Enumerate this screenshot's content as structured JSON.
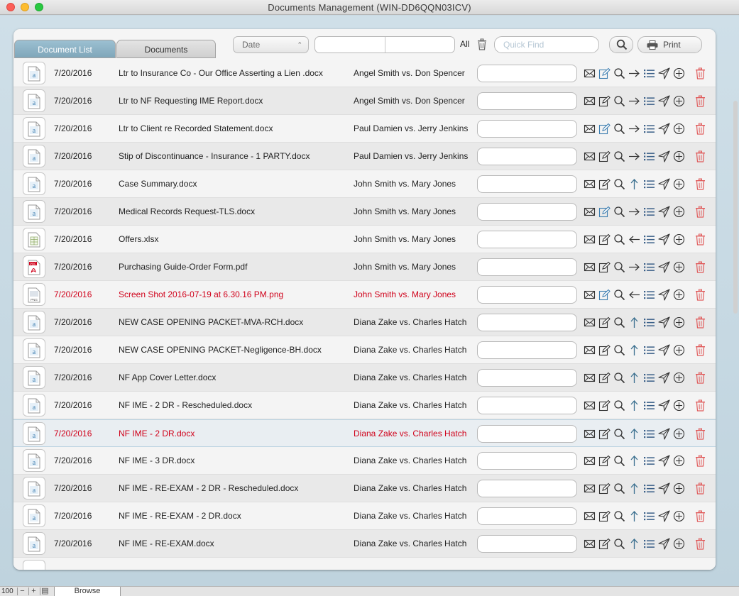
{
  "window": {
    "title": "Documents  Management (WIN-DD6QQN03ICV)"
  },
  "tabs": [
    {
      "label": "Document List",
      "active": true
    },
    {
      "label": "Documents",
      "active": false
    }
  ],
  "toolbar": {
    "date_select": "Date",
    "all_label": "All",
    "quickfind_placeholder": "Quick Find",
    "print_label": "Print"
  },
  "colors": {
    "accent": "#7fa6ba",
    "alert_red": "#d0021b",
    "trash_red": "#e05a5a",
    "icon_blue": "#3f7fb1"
  },
  "rows": [
    {
      "icon": "word-doc-icon",
      "date": "7/20/2016",
      "name": "Ltr to Insurance Co - Our Office Asserting a Lien .docx",
      "case": "Angel Smith vs. Don Spencer",
      "direction": "right-arrow-icon",
      "edit_blue": true,
      "red": false
    },
    {
      "icon": "word-doc-icon",
      "date": "7/20/2016",
      "name": "Ltr to NF Requesting IME Report.docx",
      "case": "Angel Smith vs. Don Spencer",
      "direction": "right-arrow-icon",
      "edit_blue": false,
      "red": false
    },
    {
      "icon": "word-doc-icon",
      "date": "7/20/2016",
      "name": "Ltr to Client re Recorded Statement.docx",
      "case": "Paul Damien vs. Jerry Jenkins",
      "direction": "right-arrow-icon",
      "edit_blue": true,
      "red": false
    },
    {
      "icon": "word-doc-icon",
      "date": "7/20/2016",
      "name": "Stip of Discontinuance - Insurance - 1 PARTY.docx",
      "case": "Paul Damien vs. Jerry Jenkins",
      "direction": "right-arrow-icon",
      "edit_blue": false,
      "red": false
    },
    {
      "icon": "word-doc-icon",
      "date": "7/20/2016",
      "name": "Case Summary.docx",
      "case": "John Smith vs. Mary Jones",
      "direction": "up-arrow-icon",
      "edit_blue": false,
      "red": false
    },
    {
      "icon": "word-doc-icon",
      "date": "7/20/2016",
      "name": "Medical Records Request-TLS.docx",
      "case": "John Smith vs. Mary Jones",
      "direction": "right-arrow-icon",
      "edit_blue": true,
      "red": false
    },
    {
      "icon": "spreadsheet-icon",
      "date": "7/20/2016",
      "name": "Offers.xlsx",
      "case": "John Smith vs. Mary Jones",
      "direction": "left-arrow-icon",
      "edit_blue": false,
      "red": false
    },
    {
      "icon": "pdf-icon",
      "date": "7/20/2016",
      "name": "Purchasing Guide-Order Form.pdf",
      "case": "John Smith vs. Mary Jones",
      "direction": "right-arrow-icon",
      "edit_blue": false,
      "red": false
    },
    {
      "icon": "png-icon",
      "date": "7/20/2016",
      "name": "Screen Shot 2016-07-19 at 6.30.16 PM.png",
      "case": "John Smith vs. Mary Jones",
      "direction": "left-arrow-icon",
      "edit_blue": true,
      "red": true
    },
    {
      "icon": "word-doc-icon",
      "date": "7/20/2016",
      "name": "NEW CASE OPENING PACKET-MVA-RCH.docx",
      "case": "Diana Zake vs. Charles Hatch",
      "direction": "up-arrow-icon",
      "edit_blue": false,
      "red": false
    },
    {
      "icon": "word-doc-icon",
      "date": "7/20/2016",
      "name": "NEW CASE OPENING PACKET-Negligence-BH.docx",
      "case": "Diana Zake vs. Charles Hatch",
      "direction": "up-arrow-icon",
      "edit_blue": false,
      "red": false
    },
    {
      "icon": "word-doc-icon",
      "date": "7/20/2016",
      "name": "NF App Cover Letter.docx",
      "case": "Diana Zake vs. Charles Hatch",
      "direction": "up-arrow-icon",
      "edit_blue": false,
      "red": false
    },
    {
      "icon": "word-doc-icon",
      "date": "7/20/2016",
      "name": "NF IME - 2 DR - Rescheduled.docx",
      "case": "Diana Zake vs. Charles Hatch",
      "direction": "up-arrow-icon",
      "edit_blue": false,
      "red": false
    },
    {
      "icon": "word-doc-icon",
      "date": "7/20/2016",
      "name": "NF IME - 2 DR.docx",
      "case": "Diana Zake vs. Charles Hatch",
      "direction": "up-arrow-icon",
      "edit_blue": false,
      "red": true,
      "selected": true
    },
    {
      "icon": "word-doc-icon",
      "date": "7/20/2016",
      "name": "NF IME - 3 DR.docx",
      "case": "Diana Zake vs. Charles Hatch",
      "direction": "up-arrow-icon",
      "edit_blue": false,
      "red": false
    },
    {
      "icon": "word-doc-icon",
      "date": "7/20/2016",
      "name": "NF IME - RE-EXAM - 2 DR - Rescheduled.docx",
      "case": "Diana Zake vs. Charles Hatch",
      "direction": "up-arrow-icon",
      "edit_blue": false,
      "red": false
    },
    {
      "icon": "word-doc-icon",
      "date": "7/20/2016",
      "name": "NF IME - RE-EXAM - 2 DR.docx",
      "case": "Diana Zake vs. Charles Hatch",
      "direction": "up-arrow-icon",
      "edit_blue": false,
      "red": false
    },
    {
      "icon": "word-doc-icon",
      "date": "7/20/2016",
      "name": "NF IME - RE-EXAM.docx",
      "case": "Diana Zake vs. Charles Hatch",
      "direction": "up-arrow-icon",
      "edit_blue": false,
      "red": false
    }
  ],
  "statusbar": {
    "zoom": "100",
    "mode": "Browse"
  }
}
